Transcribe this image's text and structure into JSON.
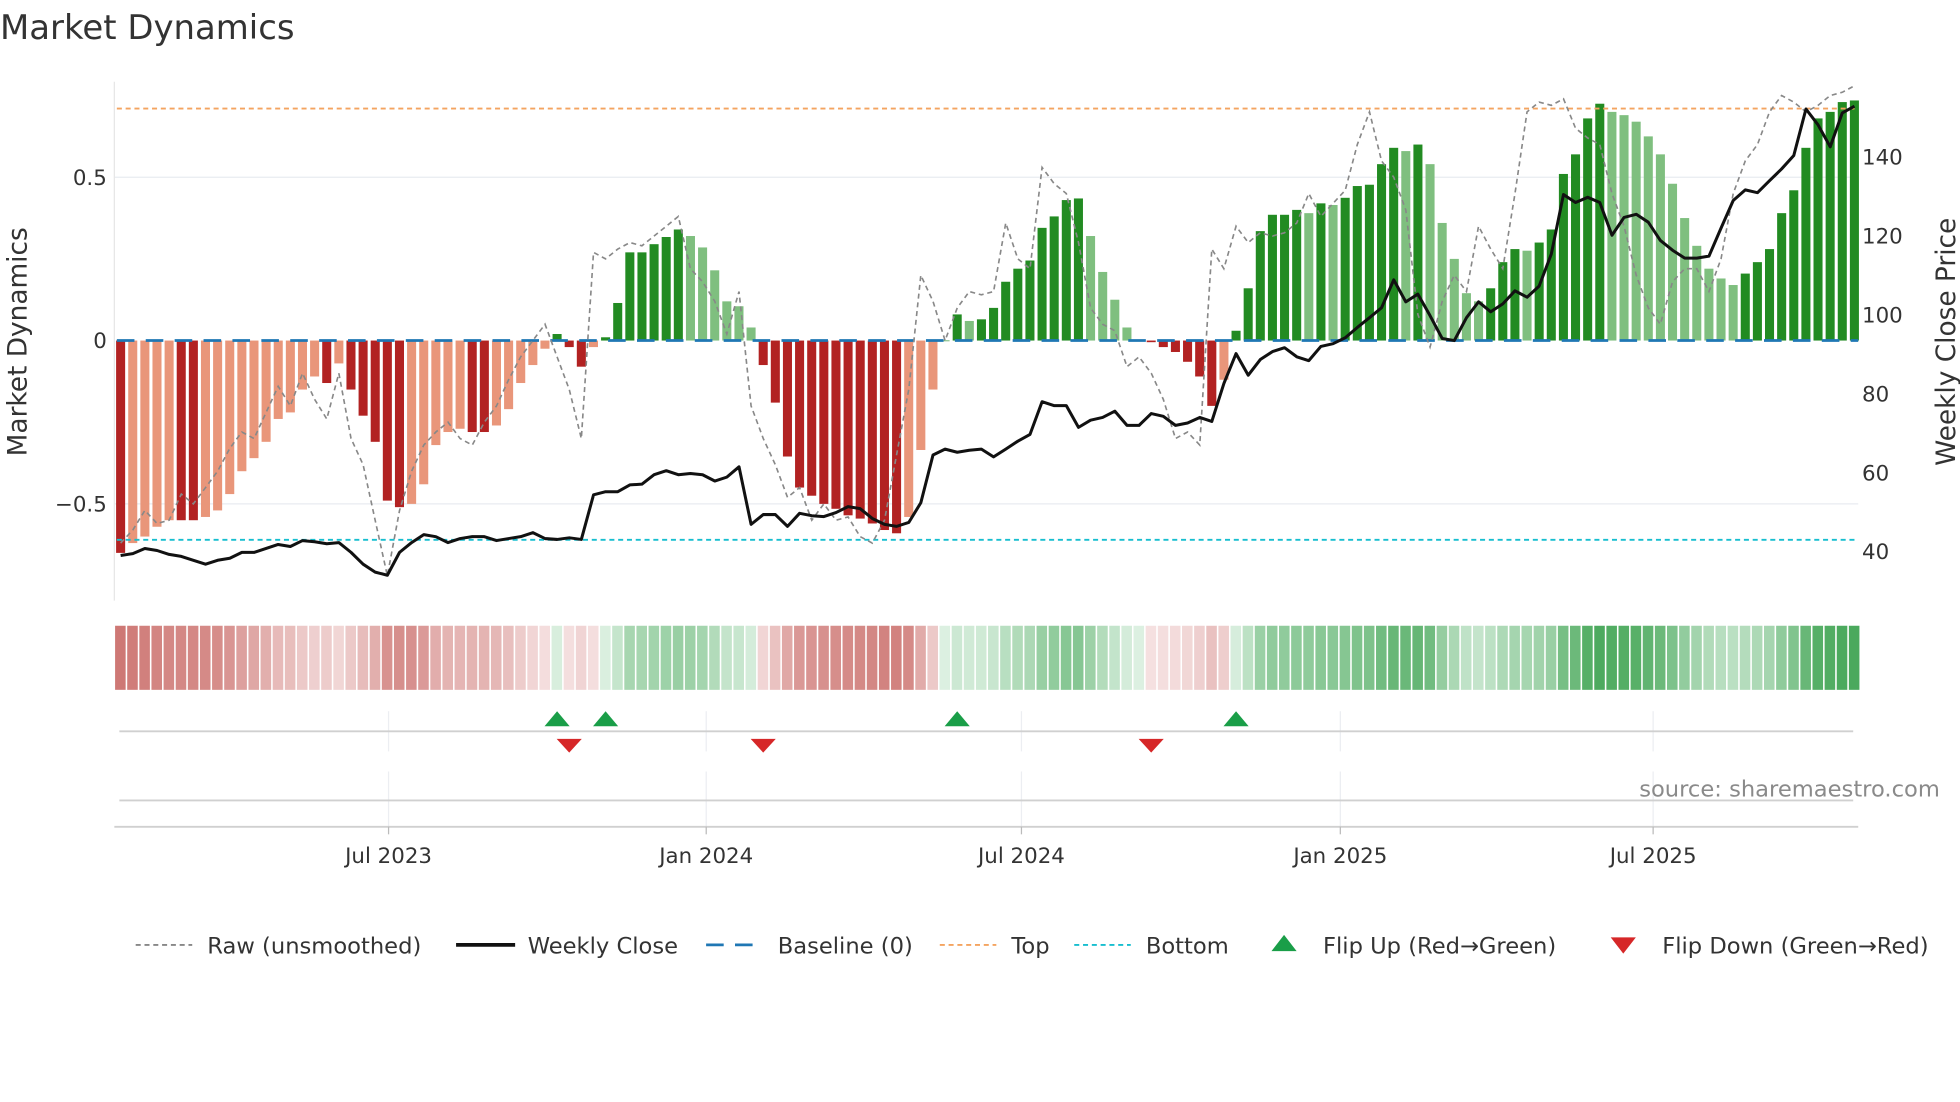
{
  "title": "Market Dynamics",
  "source": "source: sharemaestro.com",
  "colors": {
    "dark_red": "#b22222",
    "light_red": "#e9967a",
    "dark_green": "#228b22",
    "light_green": "#7fbf7f",
    "baseline": "#1f77b4",
    "top": "#f4a460",
    "bottom": "#17becf",
    "close": "#111111",
    "raw": "#888888",
    "flip_up": "#1a9e48",
    "flip_down": "#d62728"
  },
  "chart_data": {
    "type": "bar",
    "title": "Market Dynamics",
    "start_week": "2023-01-27",
    "frequency": "weekly",
    "ylabel": "Market Dynamics",
    "y2label": "Weekly Close Price",
    "ylim": [
      -0.78,
      0.8
    ],
    "y2lim": [
      30,
      160
    ],
    "yticks": [
      "0.5",
      "0",
      "−0.5"
    ],
    "ytick_values": [
      0.5,
      0,
      -0.5
    ],
    "y2ticks": [
      "40",
      "60",
      "80",
      "100",
      "120",
      "140"
    ],
    "y2tick_values": [
      40,
      60,
      80,
      100,
      120,
      140
    ],
    "xticks": [
      "Jul 2023",
      "Jan 2024",
      "Jul 2024",
      "Jan 2025",
      "Jul 2025"
    ],
    "xtick_week_index": [
      22.1,
      48.3,
      74.3,
      100.6,
      126.4
    ],
    "top_level": 0.71,
    "bottom_level": -0.61,
    "baseline": 0,
    "values": [
      -0.65,
      -0.62,
      -0.6,
      -0.57,
      -0.55,
      -0.55,
      -0.55,
      -0.54,
      -0.52,
      -0.47,
      -0.4,
      -0.36,
      -0.31,
      -0.24,
      -0.22,
      -0.15,
      -0.11,
      -0.13,
      -0.07,
      -0.15,
      -0.23,
      -0.31,
      -0.49,
      -0.51,
      -0.5,
      -0.44,
      -0.32,
      -0.28,
      -0.27,
      -0.28,
      -0.28,
      -0.26,
      -0.21,
      -0.13,
      -0.075,
      -0.025,
      0.02,
      -0.02,
      -0.08,
      -0.02,
      0.01,
      0.115,
      0.27,
      0.27,
      0.295,
      0.317,
      0.34,
      0.32,
      0.285,
      0.215,
      0.12,
      0.105,
      0.04,
      -0.075,
      -0.19,
      -0.355,
      -0.45,
      -0.475,
      -0.5,
      -0.515,
      -0.535,
      -0.545,
      -0.56,
      -0.58,
      -0.59,
      -0.54,
      -0.335,
      -0.15,
      0.0,
      0.08,
      0.06,
      0.065,
      0.1,
      0.18,
      0.22,
      0.245,
      0.345,
      0.38,
      0.43,
      0.435,
      0.32,
      0.21,
      0.125,
      0.04,
      0.0,
      -0.005,
      -0.02,
      -0.035,
      -0.065,
      -0.11,
      -0.2,
      -0.12,
      0.03,
      0.16,
      0.335,
      0.385,
      0.385,
      0.4,
      0.39,
      0.42,
      0.415,
      0.437,
      0.473,
      0.477,
      0.54,
      0.59,
      0.58,
      0.6,
      0.54,
      0.36,
      0.25,
      0.145,
      0.12,
      0.16,
      0.24,
      0.28,
      0.275,
      0.3,
      0.34,
      0.51,
      0.57,
      0.68,
      0.725,
      0.7,
      0.69,
      0.67,
      0.625,
      0.57,
      0.48,
      0.375,
      0.29,
      0.22,
      0.19,
      0.17,
      0.205,
      0.24,
      0.28,
      0.39,
      0.46,
      0.59,
      0.68,
      0.7,
      0.73,
      0.735
    ],
    "raw": [
      -0.62,
      -0.58,
      -0.52,
      -0.56,
      -0.55,
      -0.47,
      -0.5,
      -0.45,
      -0.4,
      -0.33,
      -0.28,
      -0.3,
      -0.22,
      -0.14,
      -0.2,
      -0.1,
      -0.18,
      -0.24,
      -0.1,
      -0.3,
      -0.38,
      -0.55,
      -0.72,
      -0.52,
      -0.4,
      -0.32,
      -0.28,
      -0.25,
      -0.3,
      -0.32,
      -0.25,
      -0.2,
      -0.12,
      -0.05,
      0.0,
      0.05,
      -0.05,
      -0.15,
      -0.3,
      0.27,
      0.25,
      0.28,
      0.3,
      0.29,
      0.32,
      0.35,
      0.38,
      0.22,
      0.18,
      0.12,
      0.02,
      0.15,
      -0.2,
      -0.3,
      -0.38,
      -0.48,
      -0.45,
      -0.55,
      -0.5,
      -0.55,
      -0.54,
      -0.6,
      -0.62,
      -0.55,
      -0.35,
      -0.15,
      0.2,
      0.12,
      0.0,
      0.1,
      0.15,
      0.14,
      0.15,
      0.36,
      0.25,
      0.22,
      0.53,
      0.48,
      0.45,
      0.3,
      0.1,
      0.05,
      0.03,
      -0.08,
      -0.05,
      -0.1,
      -0.18,
      -0.3,
      -0.28,
      -0.32,
      0.28,
      0.22,
      0.35,
      0.3,
      0.33,
      0.32,
      0.33,
      0.36,
      0.45,
      0.38,
      0.42,
      0.46,
      0.6,
      0.7,
      0.55,
      0.5,
      0.4,
      0.08,
      -0.02,
      0.12,
      0.2,
      0.15,
      0.35,
      0.28,
      0.22,
      0.45,
      0.7,
      0.73,
      0.72,
      0.74,
      0.65,
      0.62,
      0.6,
      0.45,
      0.35,
      0.2,
      0.1,
      0.05,
      0.18,
      0.22,
      0.22,
      0.15,
      0.25,
      0.45,
      0.55,
      0.6,
      0.7,
      0.75,
      0.73,
      0.7,
      0.72,
      0.75,
      0.76,
      0.78
    ],
    "weekly_close": [
      39,
      39.5,
      40.8,
      40.3,
      39.3,
      38.8,
      37.8,
      36.8,
      37.8,
      38.3,
      39.8,
      39.8,
      40.8,
      41.8,
      41.3,
      42.8,
      42.5,
      42,
      42.3,
      39.8,
      36.8,
      34.8,
      34,
      39.8,
      42.3,
      44.3,
      43.8,
      42.3,
      43.3,
      43.8,
      43.8,
      42.8,
      43.3,
      43.8,
      44.8,
      43.3,
      43.1,
      43.5,
      43.1,
      54.4,
      55.2,
      55.2,
      56.9,
      57.1,
      59.5,
      60.5,
      59.5,
      59.8,
      59.5,
      57.9,
      58.9,
      61.5,
      46.9,
      49.4,
      49.4,
      46.4,
      49.7,
      49.1,
      48.9,
      49.9,
      51.4,
      50.9,
      48.4,
      46.9,
      46.4,
      47.4,
      52.4,
      64.5,
      66,
      65.2,
      65.7,
      66,
      64,
      66,
      68,
      69.7,
      78,
      77,
      77,
      71.5,
      73.3,
      74,
      75.6,
      72,
      72,
      75,
      74.3,
      72,
      72.6,
      74,
      73,
      82.6,
      90.2,
      84.7,
      88.7,
      90.7,
      91.7,
      89.4,
      88.4,
      92,
      92.7,
      94.2,
      96.8,
      99.3,
      101.8,
      108.9,
      103.3,
      105.3,
      99.8,
      94,
      93.5,
      99.3,
      103.3,
      100.8,
      102.8,
      106.1,
      104.5,
      107.3,
      115.4,
      130.5,
      128.5,
      129.8,
      128.5,
      120.2,
      124.7,
      125.5,
      123.5,
      118.9,
      116.4,
      114.4,
      114.4,
      114.9,
      122,
      129,
      131.7,
      131,
      134,
      137,
      140.4,
      152.2,
      148.2,
      142.6,
      151.2,
      152.9
    ],
    "flip_up_week_index": [
      36,
      40,
      69,
      92
    ],
    "flip_down_week_index": [
      37,
      53,
      85
    ],
    "legend": {
      "placement": "bottom",
      "items": [
        {
          "label": "Raw (unsmoothed)",
          "kind": "raw"
        },
        {
          "label": "Weekly Close",
          "kind": "close"
        },
        {
          "label": "Baseline (0)",
          "kind": "baseline"
        },
        {
          "label": "Top",
          "kind": "top"
        },
        {
          "label": "Bottom",
          "kind": "bottom"
        },
        {
          "label": "Flip Up (Red→Green)",
          "kind": "up"
        },
        {
          "label": "Flip Down (Green→Red)",
          "kind": "down"
        }
      ]
    }
  }
}
